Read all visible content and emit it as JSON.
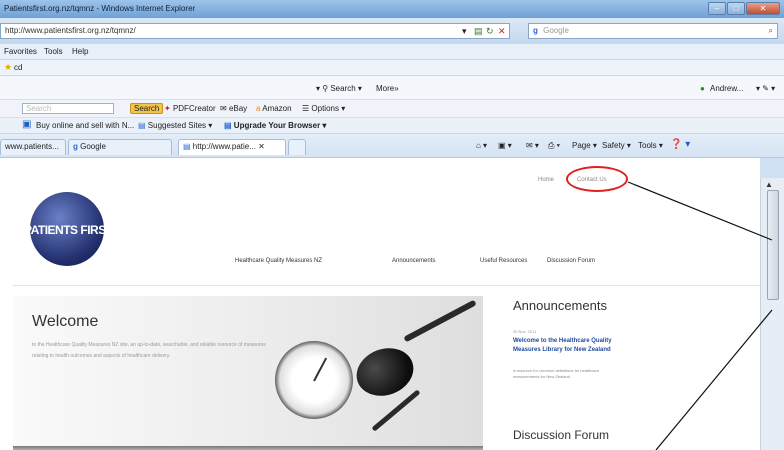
{
  "window": {
    "title": "Patientsfirst.org.nz/tqmnz - Windows Internet Explorer",
    "min_glyph": "–",
    "max_glyph": "□",
    "close_glyph": "✕"
  },
  "address_bar": {
    "url": "http://www.patientsfirst.org.nz/tqmnz/",
    "search_engine": "Google",
    "search_engine_glyph": "g"
  },
  "menu": {
    "items": [
      "Favorites",
      "Tools",
      "Help"
    ]
  },
  "favorites_bar": {
    "item": "cd"
  },
  "toolbar1": {
    "search_label": "Search",
    "more_label": "More»",
    "profile_label": "Andrew..."
  },
  "toolbar2": {
    "search_field": "Search",
    "search_btn": "Search",
    "pdfcreator": "PDFCreator",
    "ebay": "eBay",
    "amazon": "Amazon",
    "options": "Options"
  },
  "toolbar3": {
    "item1": "Buy online and sell with N...",
    "item2": "Suggested Sites",
    "item3": "Upgrade Your Browser"
  },
  "tabs": [
    {
      "label": "www.patients..."
    },
    {
      "label": "Google"
    },
    {
      "label": "http://www.patie..."
    }
  ],
  "command_bar": {
    "page": "Page",
    "safety": "Safety",
    "tools": "Tools"
  },
  "page": {
    "logo_text": "PATIENTS FIRST",
    "top_links": [
      "Home",
      "Contact Us"
    ],
    "nav": [
      "Healthcare Quality Measures NZ",
      "Announcements",
      "Useful Resources",
      "Discussion Forum"
    ],
    "hero_title": "Welcome",
    "hero_text": "to the Healthcare Quality Measures NZ site, an up-to-date, searchable, and reliable resource of measures relating to health outcomes and aspects of healthcare delivery.",
    "announcements_title": "Announcements",
    "announcement_date": "30 Nov, 2011",
    "announcement_link": "Welcome to the Healthcare Quality Measures Library for New Zealand",
    "announcement_body": "A resource for common definitions for healthcare measurements for New Zealand",
    "discussion_title": "Discussion Forum"
  },
  "colors": {
    "highlight": "#e02020",
    "brand": "#23306e",
    "link": "#1f4b9c"
  }
}
